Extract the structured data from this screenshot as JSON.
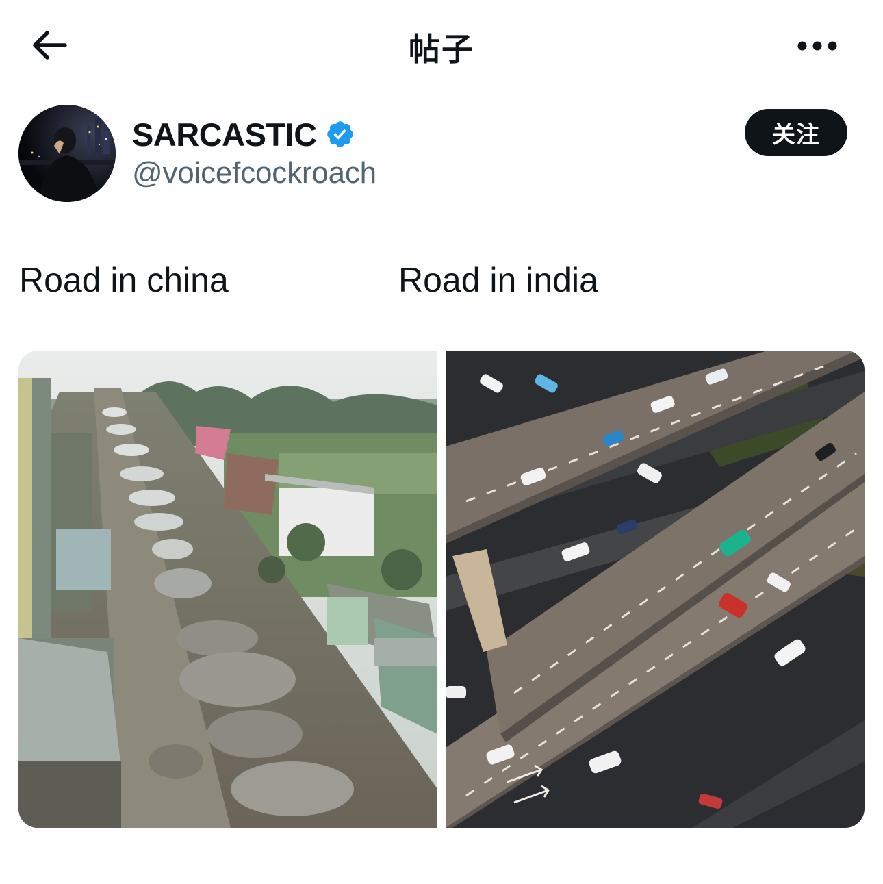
{
  "header": {
    "title": "帖子",
    "back_icon": "arrow-left-icon",
    "more_icon": "more-horizontal-icon"
  },
  "author": {
    "display_name": "SARCASTIC",
    "handle": "@voicefcockroach",
    "verified": true,
    "verified_color": "#1d9bf0",
    "follow_label": "关注"
  },
  "post": {
    "caption_left": "Road in china",
    "caption_right": "Road in india",
    "images": [
      {
        "subject": "muddy potholed dirt road with shacks, viewed from above"
      },
      {
        "subject": "aerial view of multi-level elevated highway interchange with cars"
      }
    ]
  },
  "colors": {
    "text_primary": "#0f1419",
    "text_secondary": "#536471",
    "follow_bg": "#0f1419"
  }
}
